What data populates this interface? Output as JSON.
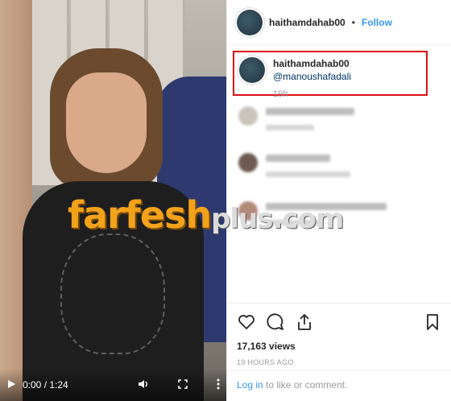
{
  "video": {
    "current_time": "0:00",
    "duration": "1:24",
    "time_separator": " / ",
    "icons": {
      "play": "play-icon",
      "volume": "volume-icon",
      "fullscreen": "fullscreen-icon",
      "more": "more-vertical-icon"
    }
  },
  "watermark": {
    "primary": "farfesh",
    "secondary": "plus.com"
  },
  "post": {
    "username": "haithamdahab00",
    "dot": "•",
    "follow_label": "Follow",
    "caption": {
      "username": "haithamdahab00",
      "mention": "@manoushafadali",
      "time": "19h"
    },
    "views": "17,163 views",
    "posted": "19 HOURS AGO",
    "login_link": "Log in",
    "login_suffix": " to like or comment."
  },
  "colors": {
    "follow": "#3897f0",
    "highlight_box": "#dd1111",
    "mention": "#003569",
    "watermark": "#f3a21c"
  }
}
